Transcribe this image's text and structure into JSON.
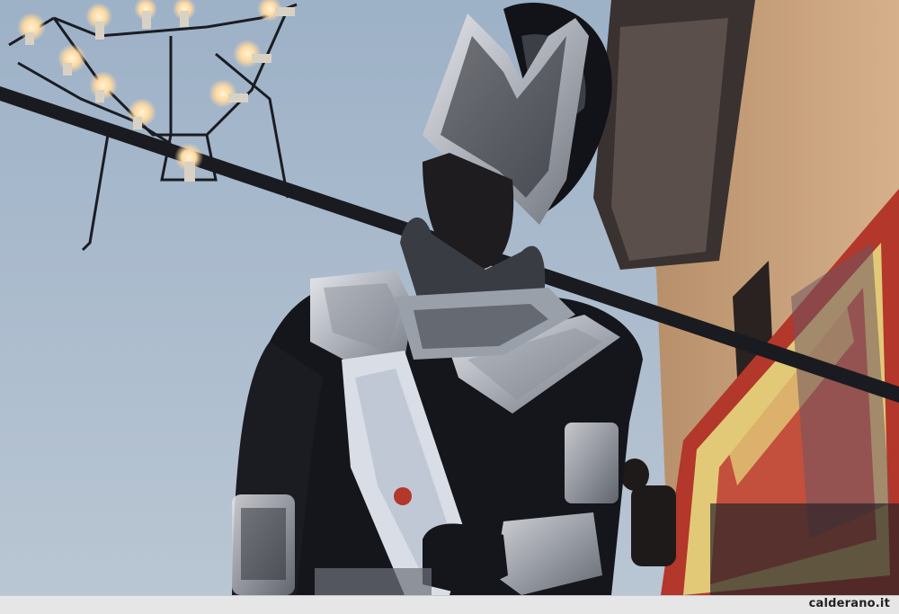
{
  "photo": {
    "subject": "",
    "colors": {
      "sky_top": "#9fb2c8",
      "sky_bottom": "#b7c4d1",
      "silhouette": "#15161c",
      "armor_silver": "#c9ccd3",
      "bulb_glow": "#ffd9a0",
      "wall": "#caa37c",
      "flag_red": "#b3372a",
      "flag_yellow": "#e2c978"
    }
  },
  "footer": {
    "watermark": "calderano.it"
  }
}
